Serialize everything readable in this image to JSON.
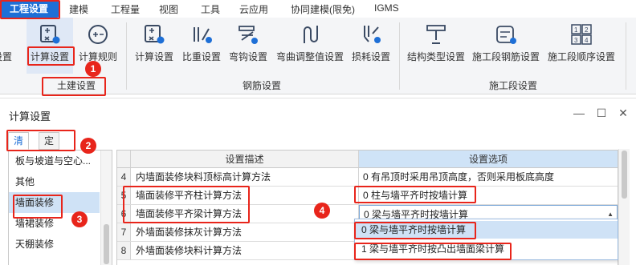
{
  "menubar": {
    "active": "工程设置",
    "items": [
      "建模",
      "工程量",
      "视图",
      "工具",
      "云应用",
      "协同建模(限免)",
      "IGMS"
    ]
  },
  "ribbon": {
    "cut_label": "设置",
    "tools_civil": [
      {
        "label": "计算设置",
        "icon": "calc-settings-icon"
      },
      {
        "label": "计算规则",
        "icon": "calc-rules-icon"
      }
    ],
    "tools_rebar": [
      {
        "label": "计算设置",
        "icon": "rebar-calc-settings-icon"
      },
      {
        "label": "比重设置",
        "icon": "density-settings-icon"
      },
      {
        "label": "弯钩设置",
        "icon": "hook-settings-icon"
      },
      {
        "label": "弯曲调整值设置",
        "icon": "bend-adjust-icon"
      },
      {
        "label": "损耗设置",
        "icon": "loss-settings-icon"
      }
    ],
    "tools_stage": [
      {
        "label": "结构类型设置",
        "icon": "structure-type-icon"
      },
      {
        "label": "施工段钢筋设置",
        "icon": "stage-rebar-icon"
      },
      {
        "label": "施工段顺序设置",
        "icon": "stage-order-icon"
      }
    ],
    "groups": {
      "civil": "土建设置",
      "rebar": "钢筋设置",
      "stage": "施工段设置"
    }
  },
  "dialog": {
    "title": "计算设置",
    "tabs": [
      "清单",
      "定额"
    ],
    "categories": [
      "板与坡道与空心...",
      "其他",
      "墙面装修",
      "墙裙装修",
      "天棚装修"
    ],
    "selected_category": "墙面装修",
    "columns": {
      "desc": "设置描述",
      "opt": "设置选项"
    },
    "rows": [
      {
        "num": "4",
        "desc": "内墙面装修块料顶标高计算方法",
        "opt": "0 有吊顶时采用吊顶高度，否则采用板底高度"
      },
      {
        "num": "5",
        "desc": "墙面装修平齐柱计算方法",
        "opt": "0 柱与墙平齐时按墙计算"
      },
      {
        "num": "6",
        "desc": "墙面装修平齐梁计算方法",
        "opt": "0 梁与墙平齐时按墙计算"
      },
      {
        "num": "7",
        "desc": "外墙面装修抹灰计算方法",
        "opt": ""
      },
      {
        "num": "8",
        "desc": "外墙面装修块料计算方法",
        "opt": ""
      }
    ],
    "dropdown_options": [
      "0 梁与墙平齐时按墙计算",
      "1 梁与墙平齐时按凸出墙面梁计算"
    ]
  },
  "annotations": [
    "1",
    "2",
    "3",
    "4"
  ],
  "colors": {
    "accent": "#1e6fd6",
    "annotation": "#e8251b",
    "selection": "#cfe2f6"
  }
}
